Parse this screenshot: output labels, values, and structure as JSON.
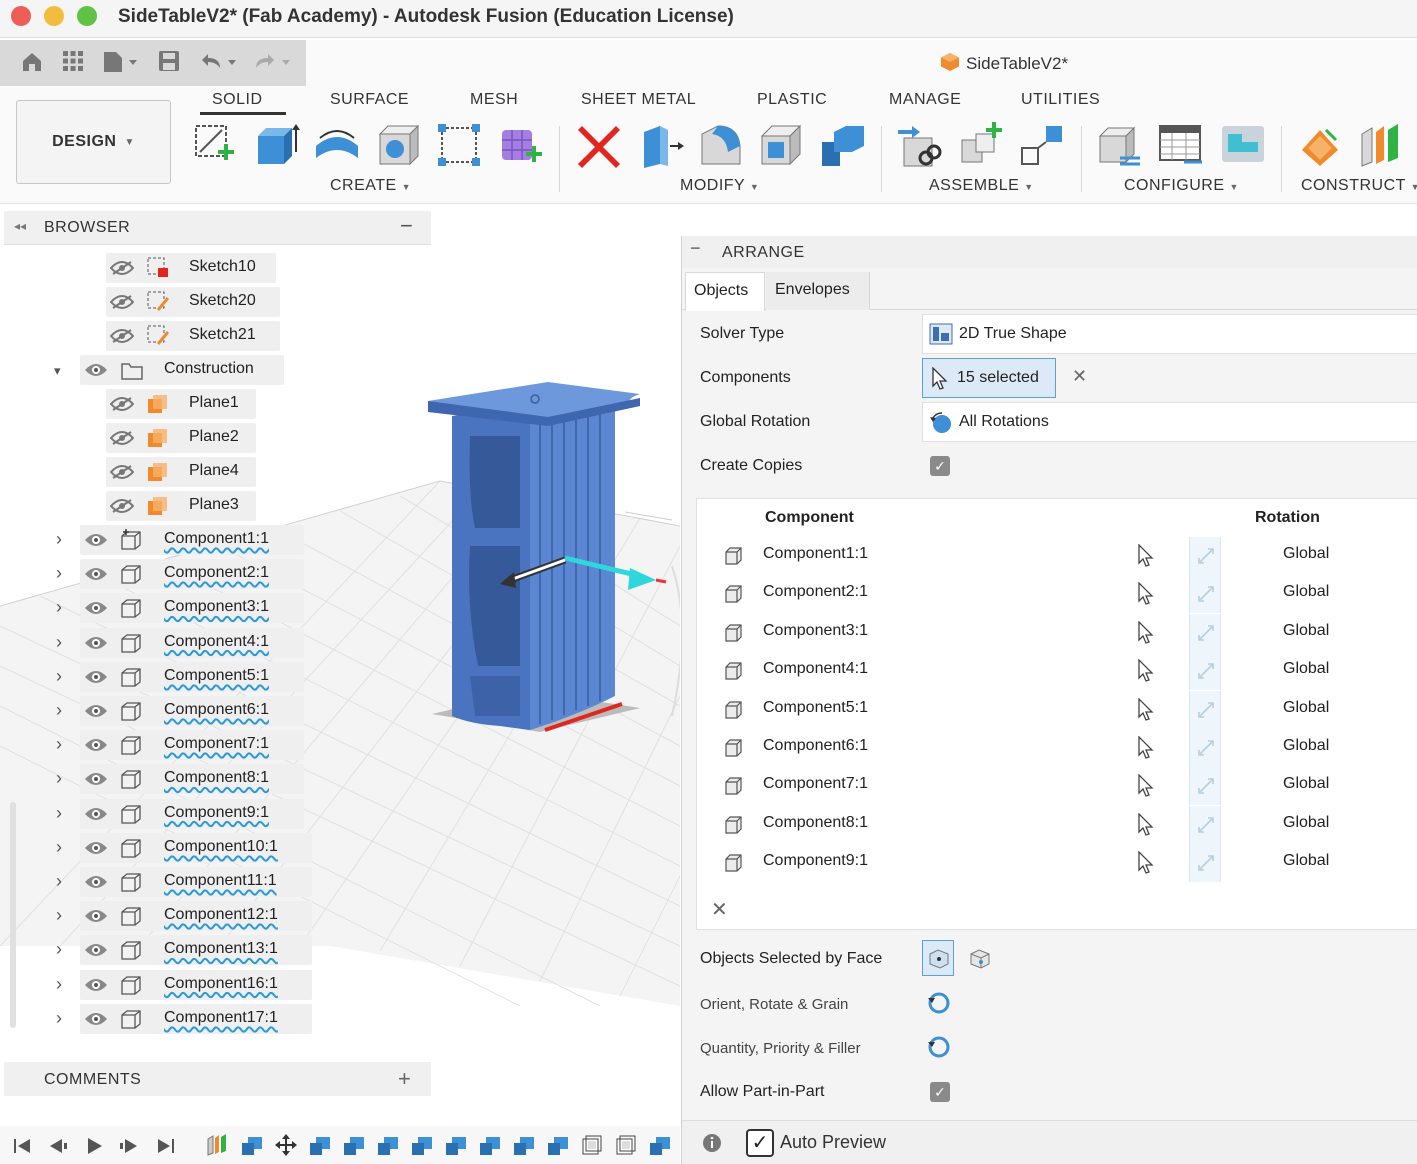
{
  "window": {
    "title": "SideTableV2* (Fab Academy) - Autodesk Fusion (Education License)"
  },
  "document_tab": {
    "title": "SideTableV2*"
  },
  "workspace": {
    "label": "DESIGN"
  },
  "ribbon": {
    "tabs": [
      "SOLID",
      "SURFACE",
      "MESH",
      "SHEET METAL",
      "PLASTIC",
      "MANAGE",
      "UTILITIES"
    ],
    "groups": {
      "create": "CREATE",
      "modify": "MODIFY",
      "assemble": "ASSEMBLE",
      "configure": "CONFIGURE",
      "construct": "CONSTRUCT"
    }
  },
  "browser": {
    "title": "BROWSER",
    "items": [
      {
        "label": "Sketch10"
      },
      {
        "label": "Sketch20"
      },
      {
        "label": "Sketch21"
      },
      {
        "label": "Construction"
      },
      {
        "label": "Plane1"
      },
      {
        "label": "Plane2"
      },
      {
        "label": "Plane4"
      },
      {
        "label": "Plane3"
      },
      {
        "label": "Component1:1"
      },
      {
        "label": "Component2:1"
      },
      {
        "label": "Component3:1"
      },
      {
        "label": "Component4:1"
      },
      {
        "label": "Component5:1"
      },
      {
        "label": "Component6:1"
      },
      {
        "label": "Component7:1"
      },
      {
        "label": "Component8:1"
      },
      {
        "label": "Component9:1"
      },
      {
        "label": "Component10:1"
      },
      {
        "label": "Component11:1"
      },
      {
        "label": "Component12:1"
      },
      {
        "label": "Component13:1"
      },
      {
        "label": "Component16:1"
      },
      {
        "label": "Component17:1"
      }
    ]
  },
  "comments": {
    "title": "COMMENTS"
  },
  "arrange": {
    "title": "ARRANGE",
    "tabs": [
      "Objects",
      "Envelopes"
    ],
    "solver_type": {
      "label": "Solver Type",
      "value": "2D True Shape"
    },
    "components": {
      "label": "Components",
      "value": "15 selected"
    },
    "global_rotation": {
      "label": "Global Rotation",
      "value": "All Rotations"
    },
    "create_copies": {
      "label": "Create Copies",
      "checked": true
    },
    "table": {
      "headers": {
        "component": "Component",
        "rotation": "Rotation"
      },
      "rows": [
        {
          "component": "Component1:1",
          "rotation": "Global"
        },
        {
          "component": "Component2:1",
          "rotation": "Global"
        },
        {
          "component": "Component3:1",
          "rotation": "Global"
        },
        {
          "component": "Component4:1",
          "rotation": "Global"
        },
        {
          "component": "Component5:1",
          "rotation": "Global"
        },
        {
          "component": "Component6:1",
          "rotation": "Global"
        },
        {
          "component": "Component7:1",
          "rotation": "Global"
        },
        {
          "component": "Component8:1",
          "rotation": "Global"
        },
        {
          "component": "Component9:1",
          "rotation": "Global"
        }
      ]
    },
    "objects_selected_by_face": {
      "label": "Objects Selected by Face"
    },
    "orient_rotate_grain": {
      "label": "Orient, Rotate & Grain"
    },
    "quantity_priority_filler": {
      "label": "Quantity, Priority & Filler"
    },
    "allow_part_in_part": {
      "label": "Allow Part-in-Part",
      "checked": true
    },
    "auto_preview": {
      "label": "Auto Preview",
      "checked": true
    }
  },
  "colors": {
    "accent_blue": "#3d8fd6",
    "body_blue": "#4a74c0",
    "tab_selected": "#ffffff"
  }
}
